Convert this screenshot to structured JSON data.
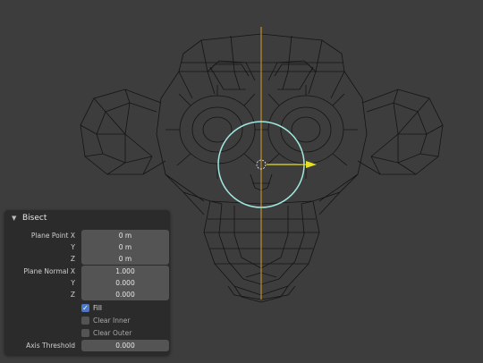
{
  "colors": {
    "background": "#3d3d3d",
    "wire": "#111111",
    "y_axis": "#e0a020",
    "gizmo_circle": "#9fe8df",
    "arrow": "#e6e020",
    "checkbox_on": "#4a78c4"
  },
  "panel": {
    "title": "Bisect",
    "collapse_icon": "triangle-down-icon",
    "plane_point": {
      "x_label": "Plane Point X",
      "x_value": "0 m",
      "y_label": "Y",
      "y_value": "0 m",
      "z_label": "Z",
      "z_value": "0 m"
    },
    "plane_normal": {
      "x_label": "Plane Normal X",
      "x_value": "1.000",
      "y_label": "Y",
      "y_value": "0.000",
      "z_label": "Z",
      "z_value": "0.000"
    },
    "fill": {
      "label": "Fill",
      "checked": true
    },
    "clear_inner": {
      "label": "Clear Inner",
      "checked": false
    },
    "clear_outer": {
      "label": "Clear Outer",
      "checked": false
    },
    "axis_threshold": {
      "label": "Axis Threshold",
      "value": "0.000"
    }
  }
}
